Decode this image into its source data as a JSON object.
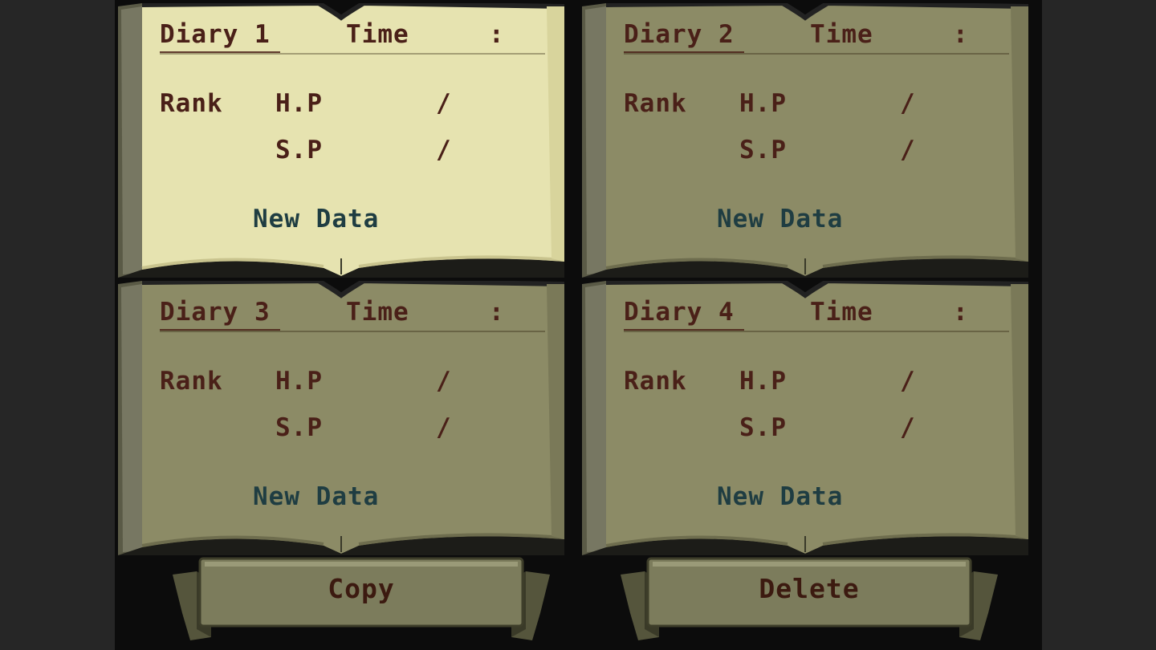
{
  "slots": [
    {
      "title": "Diary 1",
      "time_label": "Time",
      "time_sep": ":",
      "rank_label": "Rank",
      "hp_label": "H.P",
      "sp_label": "S.P",
      "hp_sep": "/",
      "sp_sep": "/",
      "status": "New Data",
      "selected": true
    },
    {
      "title": "Diary 2",
      "time_label": "Time",
      "time_sep": ":",
      "rank_label": "Rank",
      "hp_label": "H.P",
      "sp_label": "S.P",
      "hp_sep": "/",
      "sp_sep": "/",
      "status": "New Data",
      "selected": false
    },
    {
      "title": "Diary 3",
      "time_label": "Time",
      "time_sep": ":",
      "rank_label": "Rank",
      "hp_label": "H.P",
      "sp_label": "S.P",
      "hp_sep": "/",
      "sp_sep": "/",
      "status": "New Data",
      "selected": false
    },
    {
      "title": "Diary 4",
      "time_label": "Time",
      "time_sep": ":",
      "rank_label": "Rank",
      "hp_label": "H.P",
      "sp_label": "S.P",
      "hp_sep": "/",
      "sp_sep": "/",
      "status": "New Data",
      "selected": false
    }
  ],
  "buttons": {
    "copy": "Copy",
    "delete": "Delete"
  },
  "colors": {
    "page_selected": "#e6e3b0",
    "page_normal": "#8c8b66",
    "ink_brown": "#4a2018",
    "ink_blue": "#1f3d42",
    "button_face": "#7a7a5a"
  }
}
